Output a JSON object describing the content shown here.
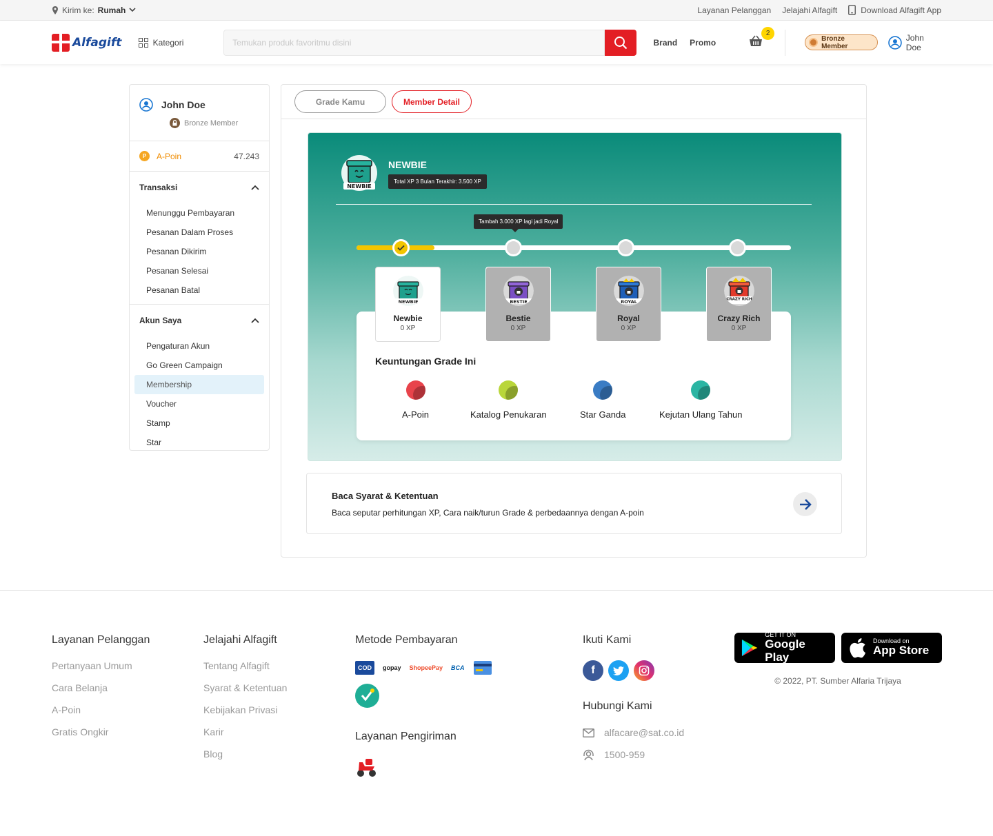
{
  "topbar": {
    "ship_label": "Kirim ke:",
    "ship_value": "Rumah",
    "links": [
      "Layanan Pelanggan",
      "Jelajahi Alfagift",
      "Download Alfagift App"
    ]
  },
  "header": {
    "logo_text": "Alfagift",
    "kategori": "Kategori",
    "search_placeholder": "Temukan produk favoritmu disini",
    "nav": [
      "Brand",
      "Promo"
    ],
    "cart_count": "2",
    "member_badge": "Bronze Member",
    "user_name": "John Doe"
  },
  "sidebar": {
    "user_name": "John Doe",
    "grade": "Bronze Member",
    "poin_label": "A-Poin",
    "poin_value": "47.243",
    "sections": [
      {
        "title": "Transaksi",
        "items": [
          "Menunggu Pembayaran",
          "Pesanan Dalam Proses",
          "Pesanan Dikirim",
          "Pesanan Selesai",
          "Pesanan Batal"
        ]
      },
      {
        "title": "Akun Saya",
        "items": [
          "Pengaturan Akun",
          "Go Green Campaign",
          "Membership",
          "Voucher",
          "Stamp",
          "Star"
        ],
        "active": "Membership"
      }
    ]
  },
  "tabs": [
    "Grade Kamu",
    "Member Detail"
  ],
  "hero": {
    "grade_name": "NEWBIE",
    "xp_total": "Total XP 3 Bulan Terakhir: 3.500 XP",
    "tooltip": "Tambah 3.000 XP lagi jadi  Royal",
    "progress_fraction": 0.18,
    "grades": [
      {
        "name": "Newbie",
        "badge": "NEWBIE",
        "xp": "0 XP",
        "color": "#1fa08d",
        "active": true
      },
      {
        "name": "Bestie",
        "badge": "BESTIE",
        "xp": "0 XP",
        "color": "#7a4fc4",
        "active": false
      },
      {
        "name": "Royal",
        "badge": "ROYAL",
        "xp": "0 XP",
        "color": "#1f5fb8",
        "active": false
      },
      {
        "name": "Crazy Rich",
        "badge": "CRAZY RICH",
        "xp": "0 XP",
        "color": "#e33a2b",
        "active": false
      }
    ],
    "benefit_title": "Keuntungan Grade Ini",
    "benefits": [
      {
        "label": "A-Poin",
        "color": "#e8434b"
      },
      {
        "label": "Katalog Penukaran",
        "color": "#b9d63a"
      },
      {
        "label": "Star Ganda",
        "color": "#3a7cc4"
      },
      {
        "label": "Kejutan Ulang Tahun",
        "color": "#2bb5a3"
      }
    ]
  },
  "terms": {
    "title": "Baca Syarat & Ketentuan",
    "desc": "Baca seputar perhitungan XP, Cara naik/turun Grade & perbedaannya dengan A-poin"
  },
  "footer": {
    "col1": {
      "title": "Layanan Pelanggan",
      "links": [
        "Pertanyaan Umum",
        "Cara Belanja",
        "A-Poin",
        "Gratis Ongkir"
      ]
    },
    "col2": {
      "title": "Jelajahi Alfagift",
      "links": [
        "Tentang Alfagift",
        "Syarat & Ketentuan",
        "Kebijakan Privasi",
        "Karir",
        "Blog"
      ]
    },
    "payment_title": "Metode Pembayaran",
    "payments": [
      "COD",
      "gopay",
      "ShopeePay",
      "BCA"
    ],
    "shipping_title": "Layanan Pengiriman",
    "follow_title": "Ikuti Kami",
    "contact_title": "Hubungi Kami",
    "email": "alfacare@sat.co.id",
    "phone": "1500-959",
    "google_small": "GET IT ON",
    "google_big": "Google Play",
    "apple_small": "Download on",
    "apple_big": "App Store",
    "copyright": "© 2022, PT. Sumber Alfaria Trijaya"
  }
}
